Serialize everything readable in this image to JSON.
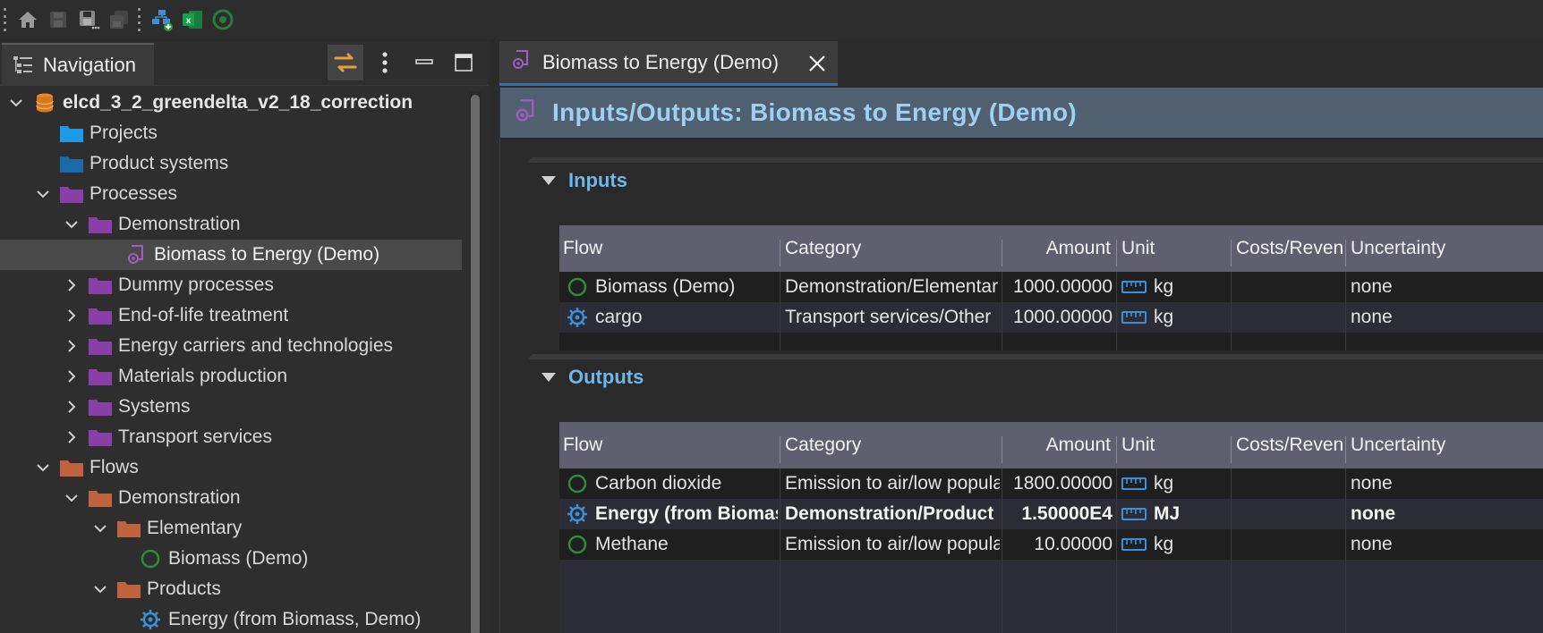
{
  "toolbar": {
    "icons": [
      "home-icon",
      "save-icon",
      "save-as-icon",
      "save-all-icon",
      "new-process-icon",
      "excel-icon",
      "run-icon"
    ]
  },
  "navigation": {
    "tab_label": "Navigation",
    "tree": [
      {
        "label": "elcd_3_2_greendelta_v2_18_correction",
        "icon": "database-icon",
        "expanded": true
      },
      {
        "label": "Projects",
        "icon": "folder-icon",
        "color": "#1b9be8"
      },
      {
        "label": "Product systems",
        "icon": "folder-icon",
        "color": "#1a6aa8"
      },
      {
        "label": "Processes",
        "icon": "folder-icon",
        "color": "#8a3fa8",
        "expanded": true
      },
      {
        "label": "Demonstration",
        "icon": "folder-icon",
        "color": "#8a3fa8",
        "expanded": true
      },
      {
        "label": "Biomass to Energy (Demo)",
        "icon": "process-icon",
        "selected": true
      },
      {
        "label": "Dummy processes",
        "icon": "folder-icon",
        "color": "#8a3fa8"
      },
      {
        "label": "End-of-life treatment",
        "icon": "folder-icon",
        "color": "#8a3fa8"
      },
      {
        "label": "Energy carriers and technologies",
        "icon": "folder-icon",
        "color": "#8a3fa8"
      },
      {
        "label": "Materials production",
        "icon": "folder-icon",
        "color": "#8a3fa8"
      },
      {
        "label": "Systems",
        "icon": "folder-icon",
        "color": "#8a3fa8"
      },
      {
        "label": "Transport services",
        "icon": "folder-icon",
        "color": "#8a3fa8"
      },
      {
        "label": "Flows",
        "icon": "folder-icon",
        "color": "#c0623e",
        "expanded": true
      },
      {
        "label": "Demonstration",
        "icon": "folder-icon",
        "color": "#c0623e",
        "expanded": true
      },
      {
        "label": "Elementary",
        "icon": "folder-icon",
        "color": "#c0623e",
        "expanded": true
      },
      {
        "label": "Biomass (Demo)",
        "icon": "elementary-flow-icon"
      },
      {
        "label": "Products",
        "icon": "folder-icon",
        "color": "#c0623e",
        "expanded": true
      },
      {
        "label": "Energy (from Biomass, Demo)",
        "icon": "product-flow-icon"
      }
    ]
  },
  "editor": {
    "tab_label": "Biomass to Energy (Demo)",
    "form_title": "Inputs/Outputs: Biomass to Energy (Demo)",
    "columns": [
      "Flow",
      "Category",
      "Amount",
      "Unit",
      "Costs/Reven",
      "Uncertainty"
    ],
    "inputs": {
      "title": "Inputs",
      "rows": [
        {
          "flow": "Biomass (Demo)",
          "flow_icon": "elementary-flow-icon",
          "category": "Demonstration/Elementar",
          "amount": "1000.00000",
          "unit": "kg",
          "costs": "",
          "uncertainty": "none",
          "bold": false
        },
        {
          "flow": "cargo",
          "flow_icon": "product-flow-icon",
          "category": "Transport services/Other",
          "amount": "1000.00000",
          "unit": "kg",
          "costs": "",
          "uncertainty": "none",
          "bold": false
        }
      ]
    },
    "outputs": {
      "title": "Outputs",
      "rows": [
        {
          "flow": "Carbon dioxide",
          "flow_icon": "elementary-flow-icon",
          "category": "Emission to air/low popula",
          "amount": "1800.00000",
          "unit": "kg",
          "costs": "",
          "uncertainty": "none",
          "bold": false
        },
        {
          "flow": "Energy (from Biomas",
          "flow_icon": "product-flow-icon",
          "category": "Demonstration/Product",
          "amount": "1.50000E4",
          "unit": "MJ",
          "costs": "",
          "uncertainty": "none",
          "bold": true
        },
        {
          "flow": "Methane",
          "flow_icon": "elementary-flow-icon",
          "category": "Emission to air/low popula",
          "amount": "10.00000",
          "unit": "kg",
          "costs": "",
          "uncertainty": "none",
          "bold": false
        }
      ]
    }
  },
  "colors": {
    "accent_blue": "#6cb8e6",
    "header_bar": "#506070",
    "grid_header": "#5f5f6f",
    "process_purple": "#a05cc0",
    "flow_orange": "#c0623e"
  }
}
